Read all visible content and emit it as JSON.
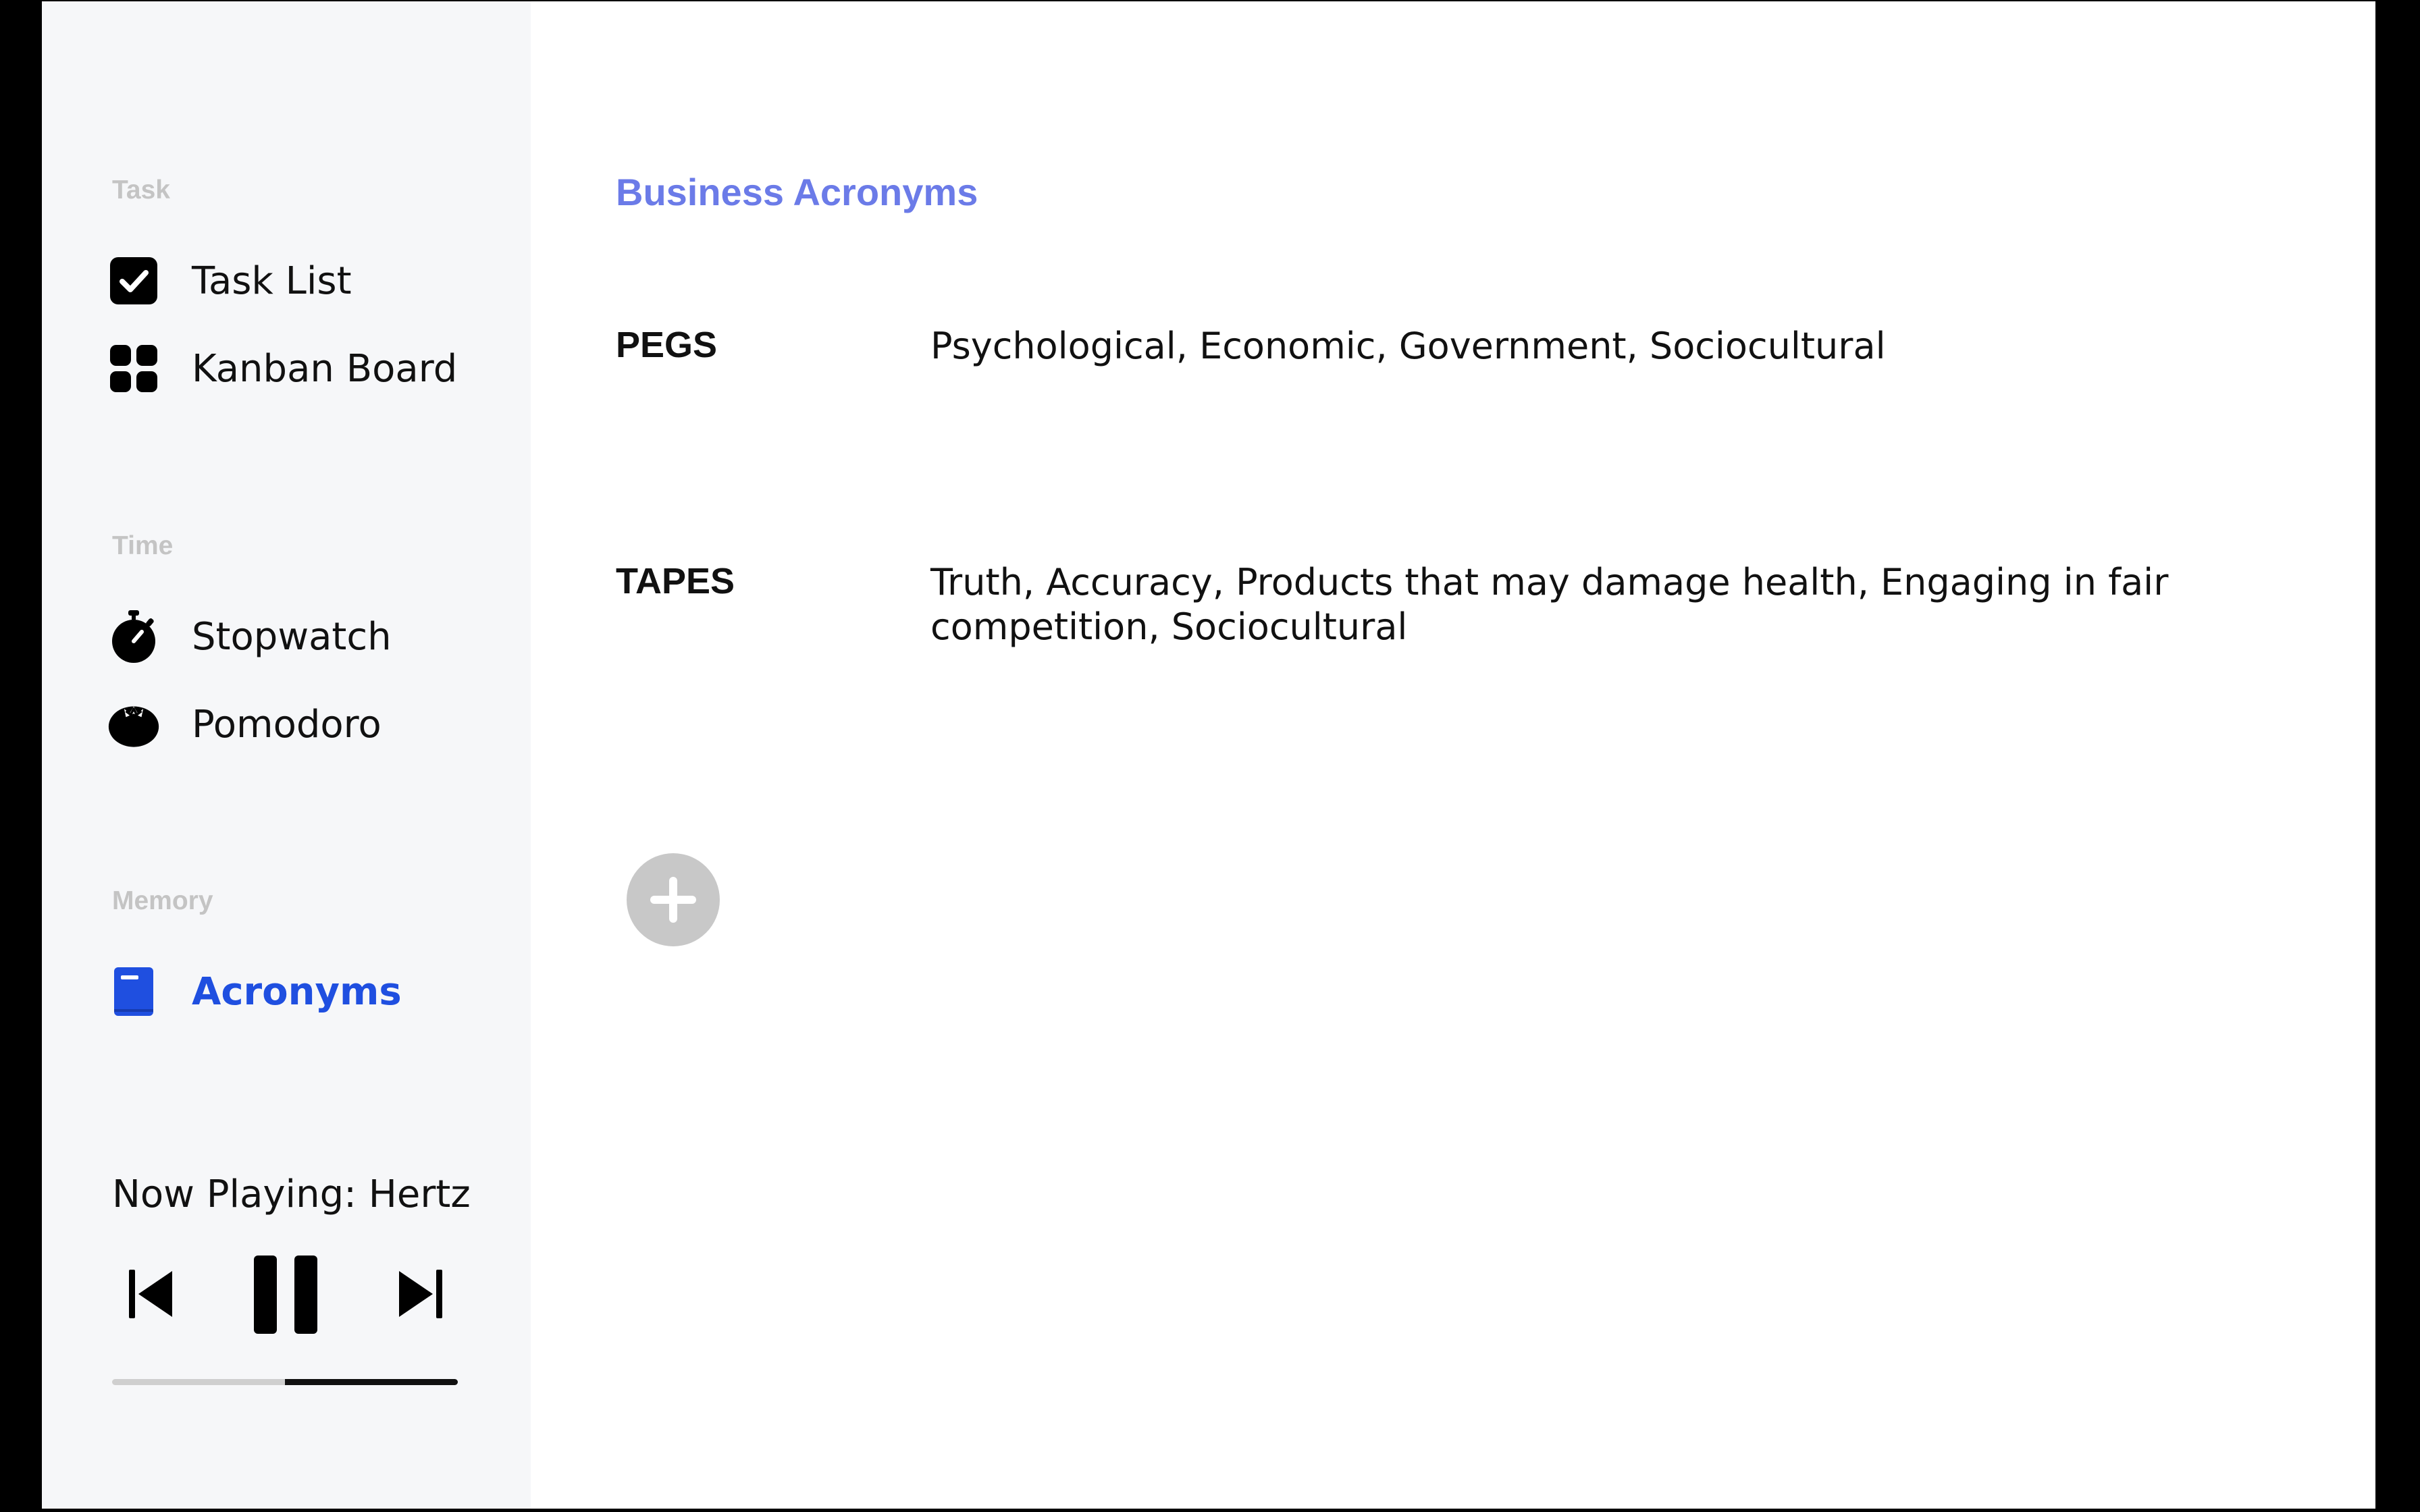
{
  "sidebar": {
    "sections": [
      {
        "title": "Task",
        "items": [
          {
            "label": "Task List",
            "icon": "checkbox-icon"
          },
          {
            "label": "Kanban Board",
            "icon": "grid-icon"
          }
        ]
      },
      {
        "title": "Time",
        "items": [
          {
            "label": "Stopwatch",
            "icon": "stopwatch-icon"
          },
          {
            "label": "Pomodoro",
            "icon": "tomato-icon"
          }
        ]
      },
      {
        "title": "Memory",
        "items": [
          {
            "label": "Acronyms",
            "icon": "book-icon",
            "active": true
          }
        ]
      }
    ],
    "player": {
      "now_playing": "Now Playing: Hertz",
      "progress": 0.5
    }
  },
  "main": {
    "title": "Business Acronyms",
    "acronyms": [
      {
        "term": "PEGS",
        "definition": "Psychological, Economic, Government, Sociocultural"
      },
      {
        "term": "TAPES",
        "definition": "Truth, Accuracy, Products that may damage health, Engaging in fair competition, Sociocultural"
      }
    ]
  },
  "colors": {
    "accent_title": "#6b7be8",
    "active_nav": "#1f4fe0",
    "sidebar_bg": "#f6f7f9",
    "section_title": "#c4c4c4",
    "add_button": "#c8c8c8"
  }
}
